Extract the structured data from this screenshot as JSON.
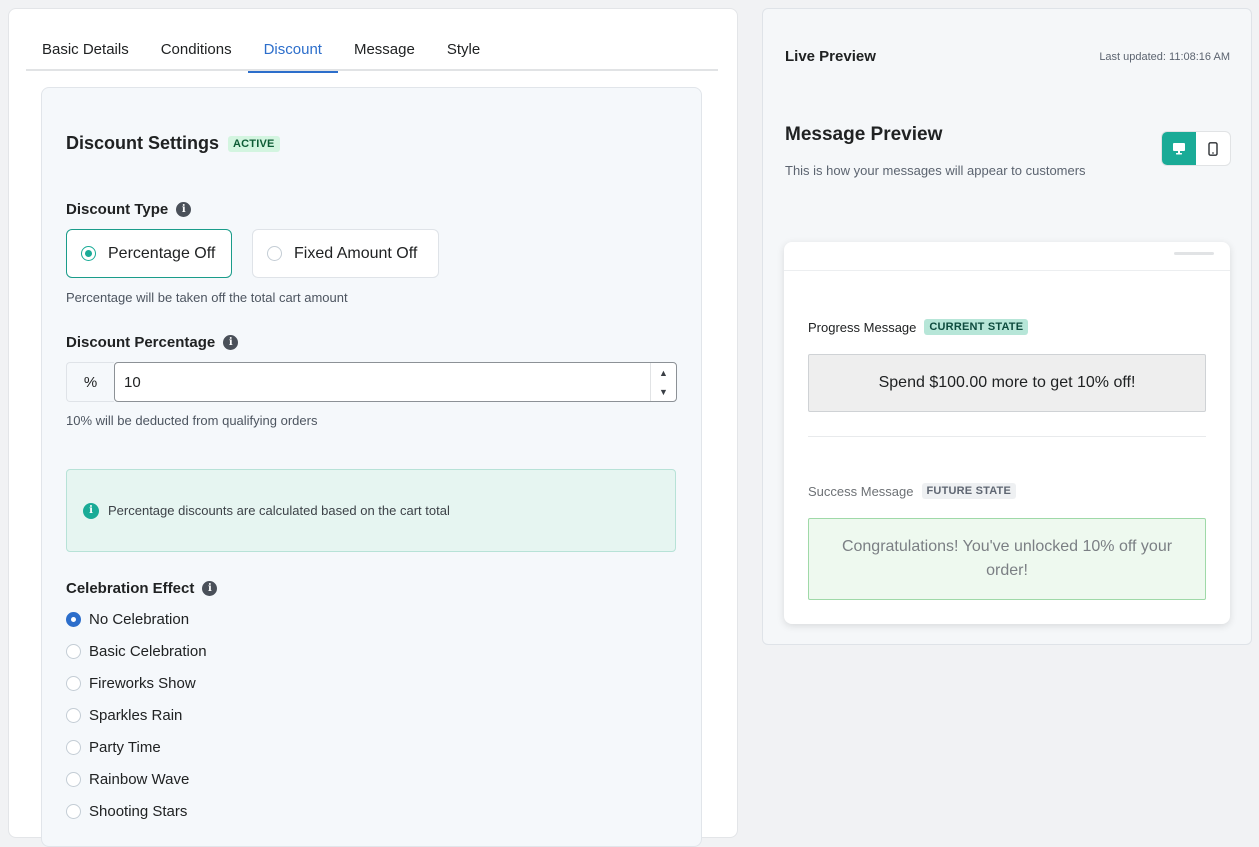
{
  "tabs": [
    "Basic Details",
    "Conditions",
    "Discount",
    "Message",
    "Style"
  ],
  "active_tab": "Discount",
  "discount_settings": {
    "title": "Discount Settings",
    "status_badge": "ACTIVE",
    "discount_type": {
      "label": "Discount Type",
      "options": [
        "Percentage Off",
        "Fixed Amount Off"
      ],
      "selected": "Percentage Off",
      "help": "Percentage will be taken off the total cart amount"
    },
    "discount_percentage": {
      "label": "Discount Percentage",
      "prefix": "%",
      "value": "10",
      "help": "10% will be deducted from qualifying orders"
    },
    "notice": "Percentage discounts are calculated based on the cart total",
    "celebration": {
      "label": "Celebration Effect",
      "options": [
        "No Celebration",
        "Basic Celebration",
        "Fireworks Show",
        "Sparkles Rain",
        "Party Time",
        "Rainbow Wave",
        "Shooting Stars"
      ],
      "selected": "No Celebration"
    }
  },
  "preview": {
    "title": "Live Preview",
    "last_updated": "Last updated: 11:08:16 AM",
    "message_preview_title": "Message Preview",
    "message_preview_subtitle": "This is how your messages will appear to customers",
    "device_selected": "desktop",
    "progress_label": "Progress Message",
    "progress_badge": "CURRENT STATE",
    "progress_text": "Spend $100.00 more to get 10% off!",
    "success_label": "Success Message",
    "success_badge": "FUTURE STATE",
    "success_text": "Congratulations! You've unlocked 10% off your order!"
  },
  "colors": {
    "accent_teal": "#1aab97",
    "accent_blue": "#2c6ecb",
    "active_badge_bg": "#d3f5e0"
  }
}
